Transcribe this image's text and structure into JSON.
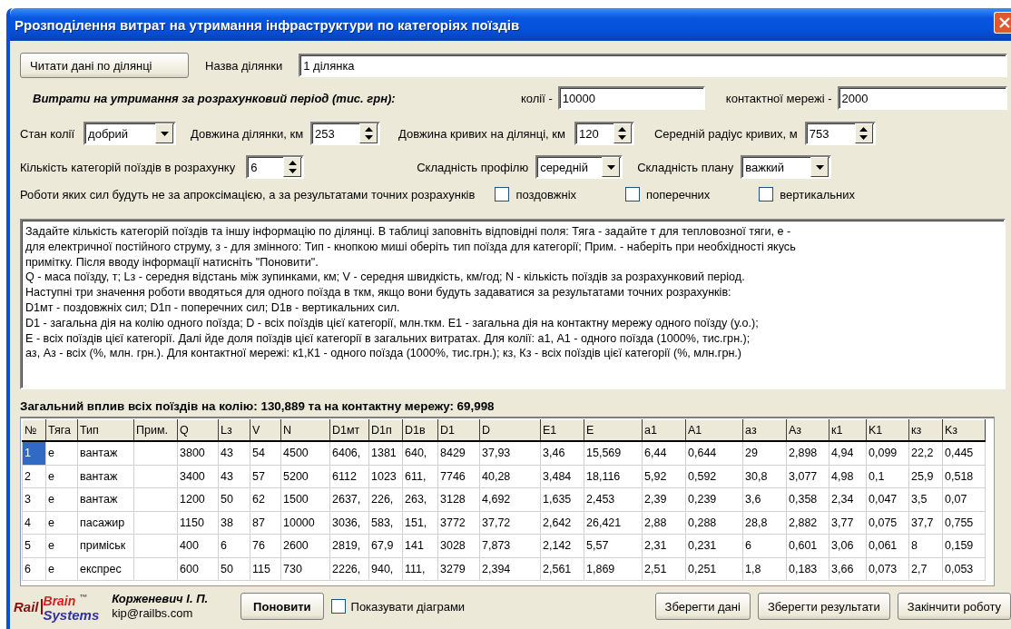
{
  "window": {
    "title": "Ррозподілення витрат на утримання  інфраструктури по категоріях поїздів"
  },
  "section": {
    "read_button": "Читати дані по ділянці",
    "name_label": "Назва ділянки",
    "name_value": "1 ділянка"
  },
  "costs": {
    "heading": "Витрати на утримання за розрахунковий період (тис. грн):",
    "track_label": "колії -",
    "track_value": "10000",
    "catenary_label": "контактної мережі -",
    "catenary_value": "2000"
  },
  "parameters_row_1": [
    {
      "kind": "label",
      "text": "Стан колії"
    },
    {
      "kind": "combo",
      "value": "добрий"
    },
    {
      "kind": "label",
      "text": "Довжина ділянки, км"
    },
    {
      "kind": "spin",
      "value": "253"
    },
    {
      "kind": "label",
      "text": "Довжина кривих на ділянці, км"
    },
    {
      "kind": "spin",
      "value": "120"
    },
    {
      "kind": "label",
      "text": "Середній радіус кривих, м"
    },
    {
      "kind": "spin",
      "value": "753"
    }
  ],
  "parameters_row_2": [
    {
      "kind": "label",
      "text": "Кількість категорій поїздів в розрахунку"
    },
    {
      "kind": "spin",
      "value": "6"
    },
    {
      "kind": "label",
      "text": "Складність профілю"
    },
    {
      "kind": "combo",
      "value": "середній"
    },
    {
      "kind": "label",
      "text": "Складність плану"
    },
    {
      "kind": "combo",
      "value": "важкий"
    }
  ],
  "exact_forces": {
    "label": "Роботи яких сил будуть не за апроксімацією, а за результатами точних розрахунків",
    "options": [
      {
        "label": "поздовжніх",
        "checked": false
      },
      {
        "label": "поперечних",
        "checked": false
      },
      {
        "label": "вертикальних",
        "checked": false
      }
    ]
  },
  "help_text": [
    "Задайте кількість категорій поїздів та іншу інформацію по ділянці. В таблиці заповніть відповідні поля: Тяга - задайте т для тепловозної тяги, е -",
    "для електричної постійного струму, з - для змінного: Тип - кнопкою миші оберіть тип поїзда для категорії; Прим. - наберіть при необхідності якусь",
    "примітку. Після вводу інформації натисніть \"Поновити\".",
    "Q - маса поїзду, т; Lз - середня відстань між зупинками, км; V - середня швидкість, км/год; N - кількість поїздів за розрахунковий період.",
    "Наступні три значення роботи вводяться для одного поїзда в ткм, якщо вони будуть задаватися за результатами точних розрахунків:",
    "D1мт - поздовжніх сил; D1п -  поперечних сил; D1в - вертикальних сил.",
    "D1 - загальна дія на колію одного поїзда; D - всіх поїздів цієї категорії, млн.ткм. E1 - загальна дія на контактну мережу одного поїзду (у.о.);",
    "E - всіх поїздів цієї категорії. Далі йде доля поїздів цієї категорії в загальних витратах. Для колії: а1, А1 - одного поїзда  (1000%, тис.грн.);",
    "аз, Аз - всіх (%, млн. грн.). Для контактної мережі: к1,К1 - одного поїзда (1000%, тис.грн.); кз, Кз - всіх поїздів цієї категорії (%, млн.грн.)"
  ],
  "summary": "Загальний вплив всіх поїздів на колію: 130,889 та на контактну мережу: 69,998",
  "table": {
    "columns": [
      "№",
      "Тяга",
      "Тип",
      "Прим.",
      "Q",
      "Lз",
      "V",
      "N",
      "D1мт",
      "D1п",
      "D1в",
      "D1",
      "D",
      "E1",
      "E",
      "a1",
      "A1",
      "aз",
      "Aз",
      "к1",
      "K1",
      "кз",
      "Kз"
    ],
    "rows": [
      {
        "selected": true,
        "cells": [
          "1",
          "е",
          "вантаж",
          "",
          "3800",
          "43",
          "54",
          "4500",
          "6406,",
          "1381",
          "640,",
          "8429",
          "37,93",
          "3,46",
          "15,569",
          "6,44",
          "0,644",
          "29",
          "2,898",
          "4,94",
          "0,099",
          "22,2",
          "0,445"
        ]
      },
      {
        "selected": false,
        "cells": [
          "2",
          "е",
          "вантаж",
          "",
          "3400",
          "43",
          "57",
          "5200",
          "6112",
          "1023",
          "611,",
          "7746",
          "40,28",
          "3,484",
          "18,116",
          "5,92",
          "0,592",
          "30,8",
          "3,077",
          "4,98",
          "0,1",
          "25,9",
          "0,518"
        ]
      },
      {
        "selected": false,
        "cells": [
          "3",
          "е",
          "вантаж",
          "",
          "1200",
          "50",
          "62",
          "1500",
          "2637,",
          "226,",
          "263,",
          "3128",
          "4,692",
          "1,635",
          "2,453",
          "2,39",
          "0,239",
          "3,6",
          "0,358",
          "2,34",
          "0,047",
          "3,5",
          "0,07"
        ]
      },
      {
        "selected": false,
        "cells": [
          "4",
          "е",
          "пасажир",
          "",
          "1150",
          "38",
          "87",
          "10000",
          "3036,",
          "583,",
          "151,",
          "3772",
          "37,72",
          "2,642",
          "26,421",
          "2,88",
          "0,288",
          "28,8",
          "2,882",
          "3,77",
          "0,075",
          "37,7",
          "0,755"
        ]
      },
      {
        "selected": false,
        "cells": [
          "5",
          "е",
          "приміськ",
          "",
          "400",
          "6",
          "76",
          "2600",
          "2819,",
          "67,9",
          "141",
          "3028",
          "7,873",
          "2,142",
          "5,57",
          "2,31",
          "0,231",
          "6",
          "0,601",
          "3,06",
          "0,061",
          "8",
          "0,159"
        ]
      },
      {
        "selected": false,
        "cells": [
          "6",
          "е",
          "експрес",
          "",
          "600",
          "50",
          "115",
          "730",
          "2226,",
          "940,",
          "111,",
          "3279",
          "2,394",
          "2,561",
          "1,869",
          "2,51",
          "0,251",
          "1,8",
          "0,183",
          "3,66",
          "0,073",
          "2,7",
          "0,053"
        ]
      }
    ]
  },
  "footer": {
    "logo": {
      "left": "Rail",
      "top": "Brain",
      "mark": "™",
      "bottom": "Systems"
    },
    "author": "Корженевич І. П.",
    "email": "kip@railbs.com",
    "refresh_button": "Поновити",
    "show_charts": {
      "label": "Показувати діаграми",
      "checked": false
    },
    "buttons": [
      "Зберегти дані",
      "Зберегти результати",
      "Закінчити роботу"
    ]
  }
}
